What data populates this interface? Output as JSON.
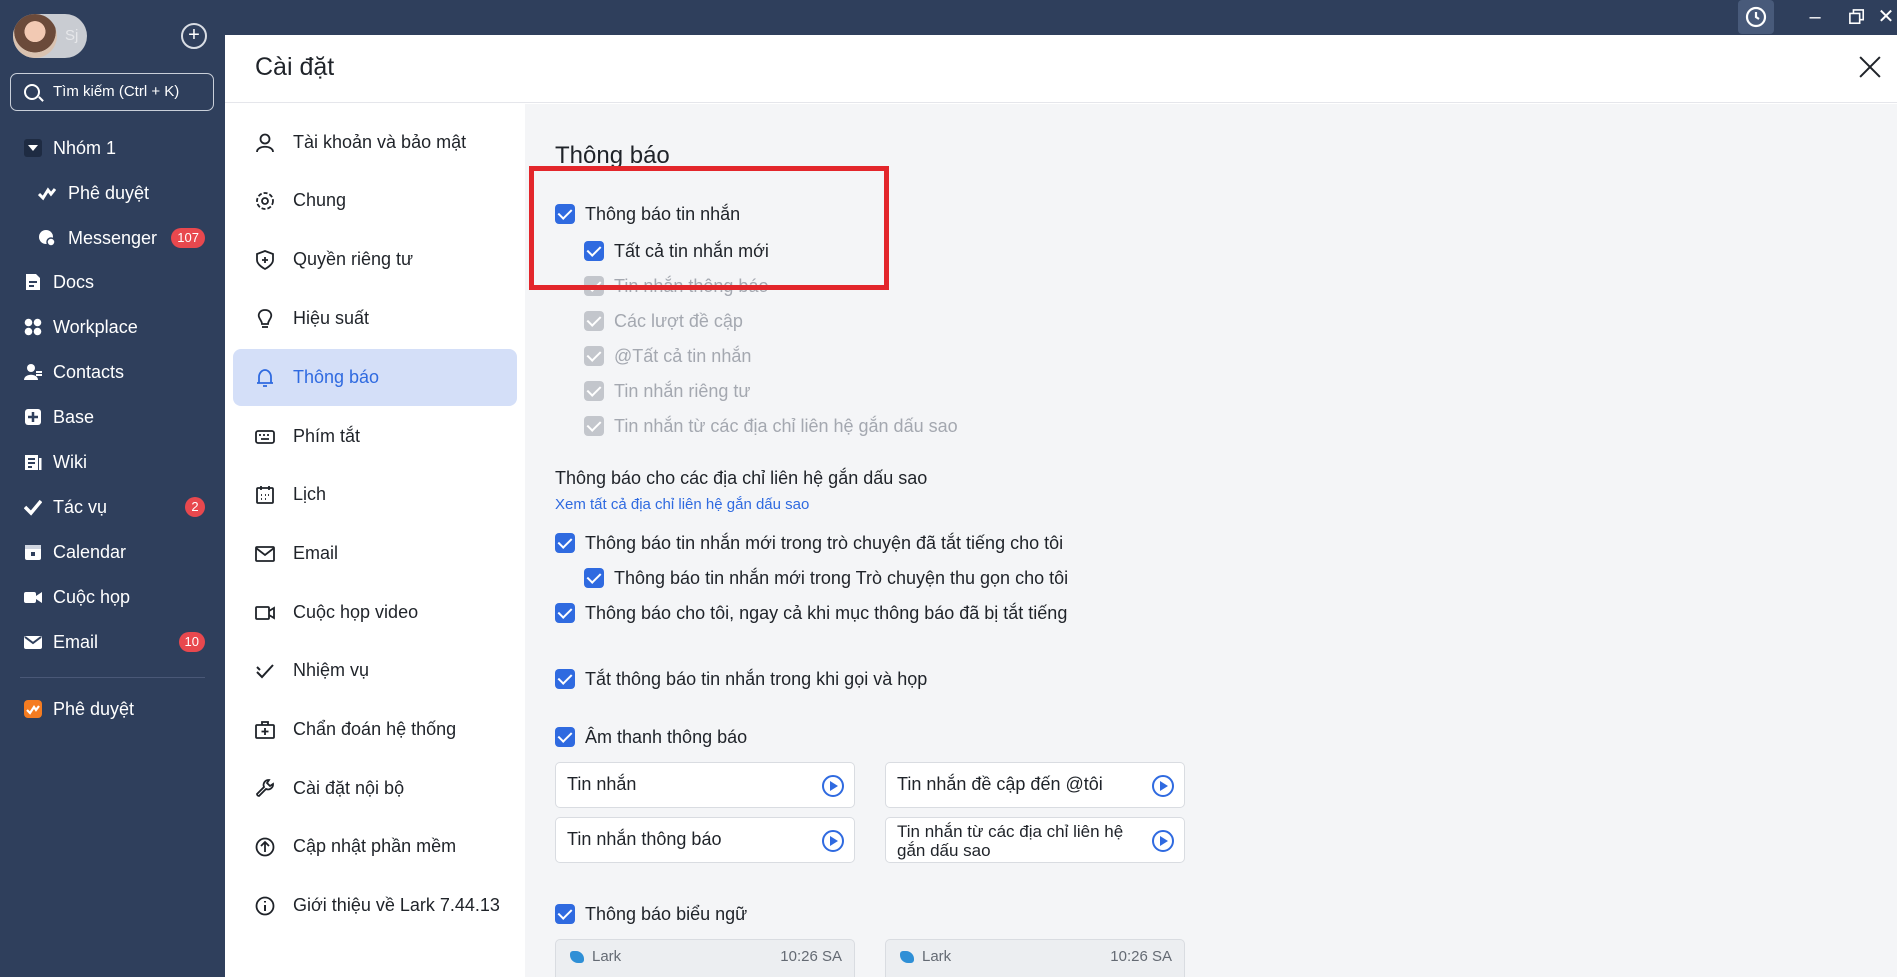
{
  "sidebar": {
    "user_initial": "Sj",
    "search_placeholder": "Tìm kiếm (Ctrl + K)",
    "items": [
      {
        "label": "Nhóm 1",
        "icon": "caret-down-icon"
      },
      {
        "label": "Phê duyệt",
        "icon": "approval-icon"
      },
      {
        "label": "Messenger",
        "icon": "messenger-icon",
        "badge": "107"
      },
      {
        "label": "Docs",
        "icon": "docs-icon"
      },
      {
        "label": "Workplace",
        "icon": "workplace-icon"
      },
      {
        "label": "Contacts",
        "icon": "contacts-icon"
      },
      {
        "label": "Base",
        "icon": "base-icon"
      },
      {
        "label": "Wiki",
        "icon": "wiki-icon"
      },
      {
        "label": "Tác vụ",
        "icon": "task-icon",
        "badge": "2"
      },
      {
        "label": "Calendar",
        "icon": "calendar-icon"
      },
      {
        "label": "Cuộc họp",
        "icon": "video-icon"
      },
      {
        "label": "Email",
        "icon": "mail-icon",
        "badge": "10"
      },
      {
        "label": "Phê duyệt",
        "icon": "approval-app-icon"
      }
    ]
  },
  "settings": {
    "title": "Cài đặt",
    "menu": [
      {
        "label": "Tài khoản và bảo mật",
        "icon": "user-icon"
      },
      {
        "label": "Chung",
        "icon": "gear-icon"
      },
      {
        "label": "Quyền riêng tư",
        "icon": "shield-icon"
      },
      {
        "label": "Hiệu suất",
        "icon": "bulb-icon"
      },
      {
        "label": "Thông báo",
        "icon": "bell-icon",
        "active": true
      },
      {
        "label": "Phím tắt",
        "icon": "keyboard-icon"
      },
      {
        "label": "Lịch",
        "icon": "calendar-icon"
      },
      {
        "label": "Email",
        "icon": "mail-icon"
      },
      {
        "label": "Cuộc họp video",
        "icon": "video-icon"
      },
      {
        "label": "Nhiệm vụ",
        "icon": "task-icon"
      },
      {
        "label": "Chẩn đoán hệ thống",
        "icon": "medkit-icon"
      },
      {
        "label": "Cài đặt nội bộ",
        "icon": "wrench-icon"
      },
      {
        "label": "Cập nhật phần mềm",
        "icon": "upload-icon"
      },
      {
        "label": "Giới thiệu về Lark 7.44.13",
        "icon": "info-icon"
      }
    ]
  },
  "notifications": {
    "title": "Thông báo",
    "message_notif": "Thông báo tin nhắn",
    "all_new": "Tất cả tin nhắn mới",
    "disabled": [
      "Tin nhắn thông báo",
      "Các lượt đề cập",
      "@Tất cả tin nhắn",
      "Tin nhắn riêng tư",
      "Tin nhắn từ các địa chỉ liên hệ gắn dấu sao"
    ],
    "starred_heading": "Thông báo cho các địa chỉ liên hệ gắn dấu sao",
    "starred_link": "Xem tất cả địa chỉ liên hệ gắn dấu sao",
    "muted_chats": "Thông báo tin nhắn mới trong trò chuyện đã tắt tiếng cho tôi",
    "collapsed_chats": "Thông báo tin nhắn mới trong Trò chuyện thu gọn cho tôi",
    "even_muted": "Thông báo cho tôi, ngay cả khi mục thông báo đã bị tắt tiếng",
    "mute_in_call": "Tắt thông báo tin nhắn trong khi gọi và họp",
    "sound": "Âm thanh thông báo",
    "sounds": [
      "Tin nhắn",
      "Tin nhắn đề cập đến @tôi",
      "Tin nhắn thông báo",
      "Tin nhắn từ các địa chỉ liên hệ gắn dấu sao"
    ],
    "banner": "Thông báo biểu ngữ",
    "preview_app": "Lark",
    "preview_time": "10:26 SA"
  },
  "colors": {
    "accent": "#2f6ae0",
    "sidebar": "#2f3f5c",
    "highlight": "#e3262b",
    "badge": "#e8484e"
  }
}
